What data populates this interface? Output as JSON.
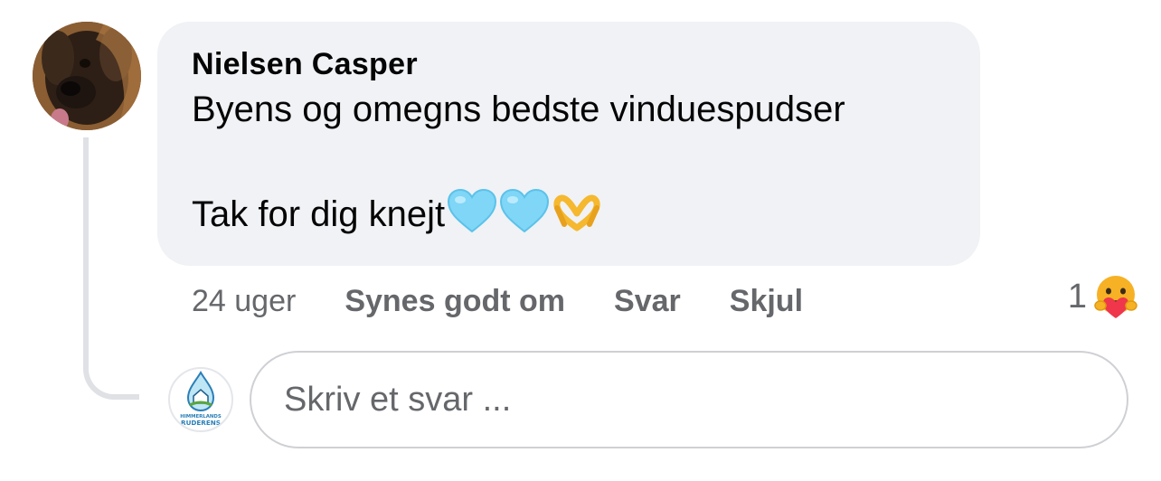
{
  "comment": {
    "author": "Nielsen Casper",
    "line1": "Byens og omegns bedste vinduespudser",
    "line2": "Tak for dig knejt",
    "emojis": [
      "light-blue-heart-icon",
      "light-blue-heart-icon",
      "heart-hands-icon"
    ],
    "time": "24 uger",
    "like_label": "Synes godt om",
    "reply_label": "Svar",
    "hide_label": "Skjul",
    "reaction_count": "1",
    "reaction_icon": "care-reaction-icon"
  },
  "reply": {
    "placeholder": "Skriv et svar ...",
    "logo_text_top": "HIMMERLANDS",
    "logo_text_bottom": "RUDERENS"
  },
  "colors": {
    "bubble": "#f0f2f5",
    "secondary_text": "#65676b",
    "heart": "#7fd6f6"
  }
}
